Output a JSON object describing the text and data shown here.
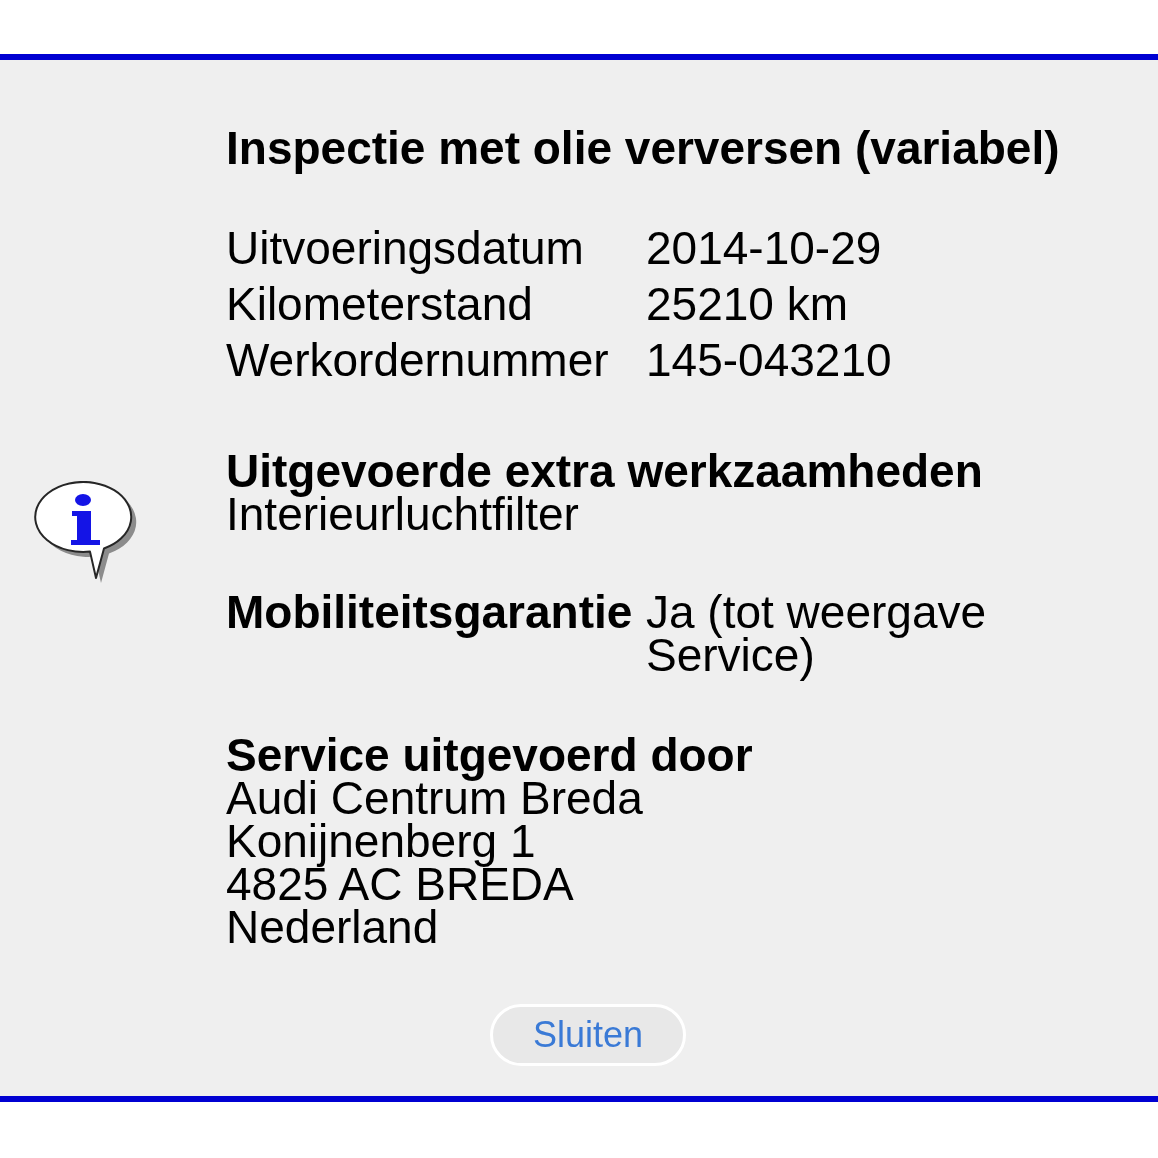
{
  "title": "Inspectie met olie verversen (variabel)",
  "details": [
    {
      "label": "Uitvoeringsdatum",
      "value": "2014-10-29"
    },
    {
      "label": "Kilometerstand",
      "value": "25210 km"
    },
    {
      "label": "Werkordernummer",
      "value": "145-043210"
    }
  ],
  "extra_work": {
    "heading": "Uitgevoerde extra werkzaamheden",
    "items": [
      "Interieurluchtfilter"
    ]
  },
  "mobility_guarantee": {
    "label": "Mobiliteitsgarantie",
    "value": "Ja (tot weergave Service)"
  },
  "service_by": {
    "heading": "Service uitgevoerd door",
    "address_lines": [
      "Audi Centrum Breda",
      "Konijnenberg 1",
      "4825 AC BREDA",
      "Nederland"
    ]
  },
  "close_button": {
    "label": "Sluiten"
  }
}
